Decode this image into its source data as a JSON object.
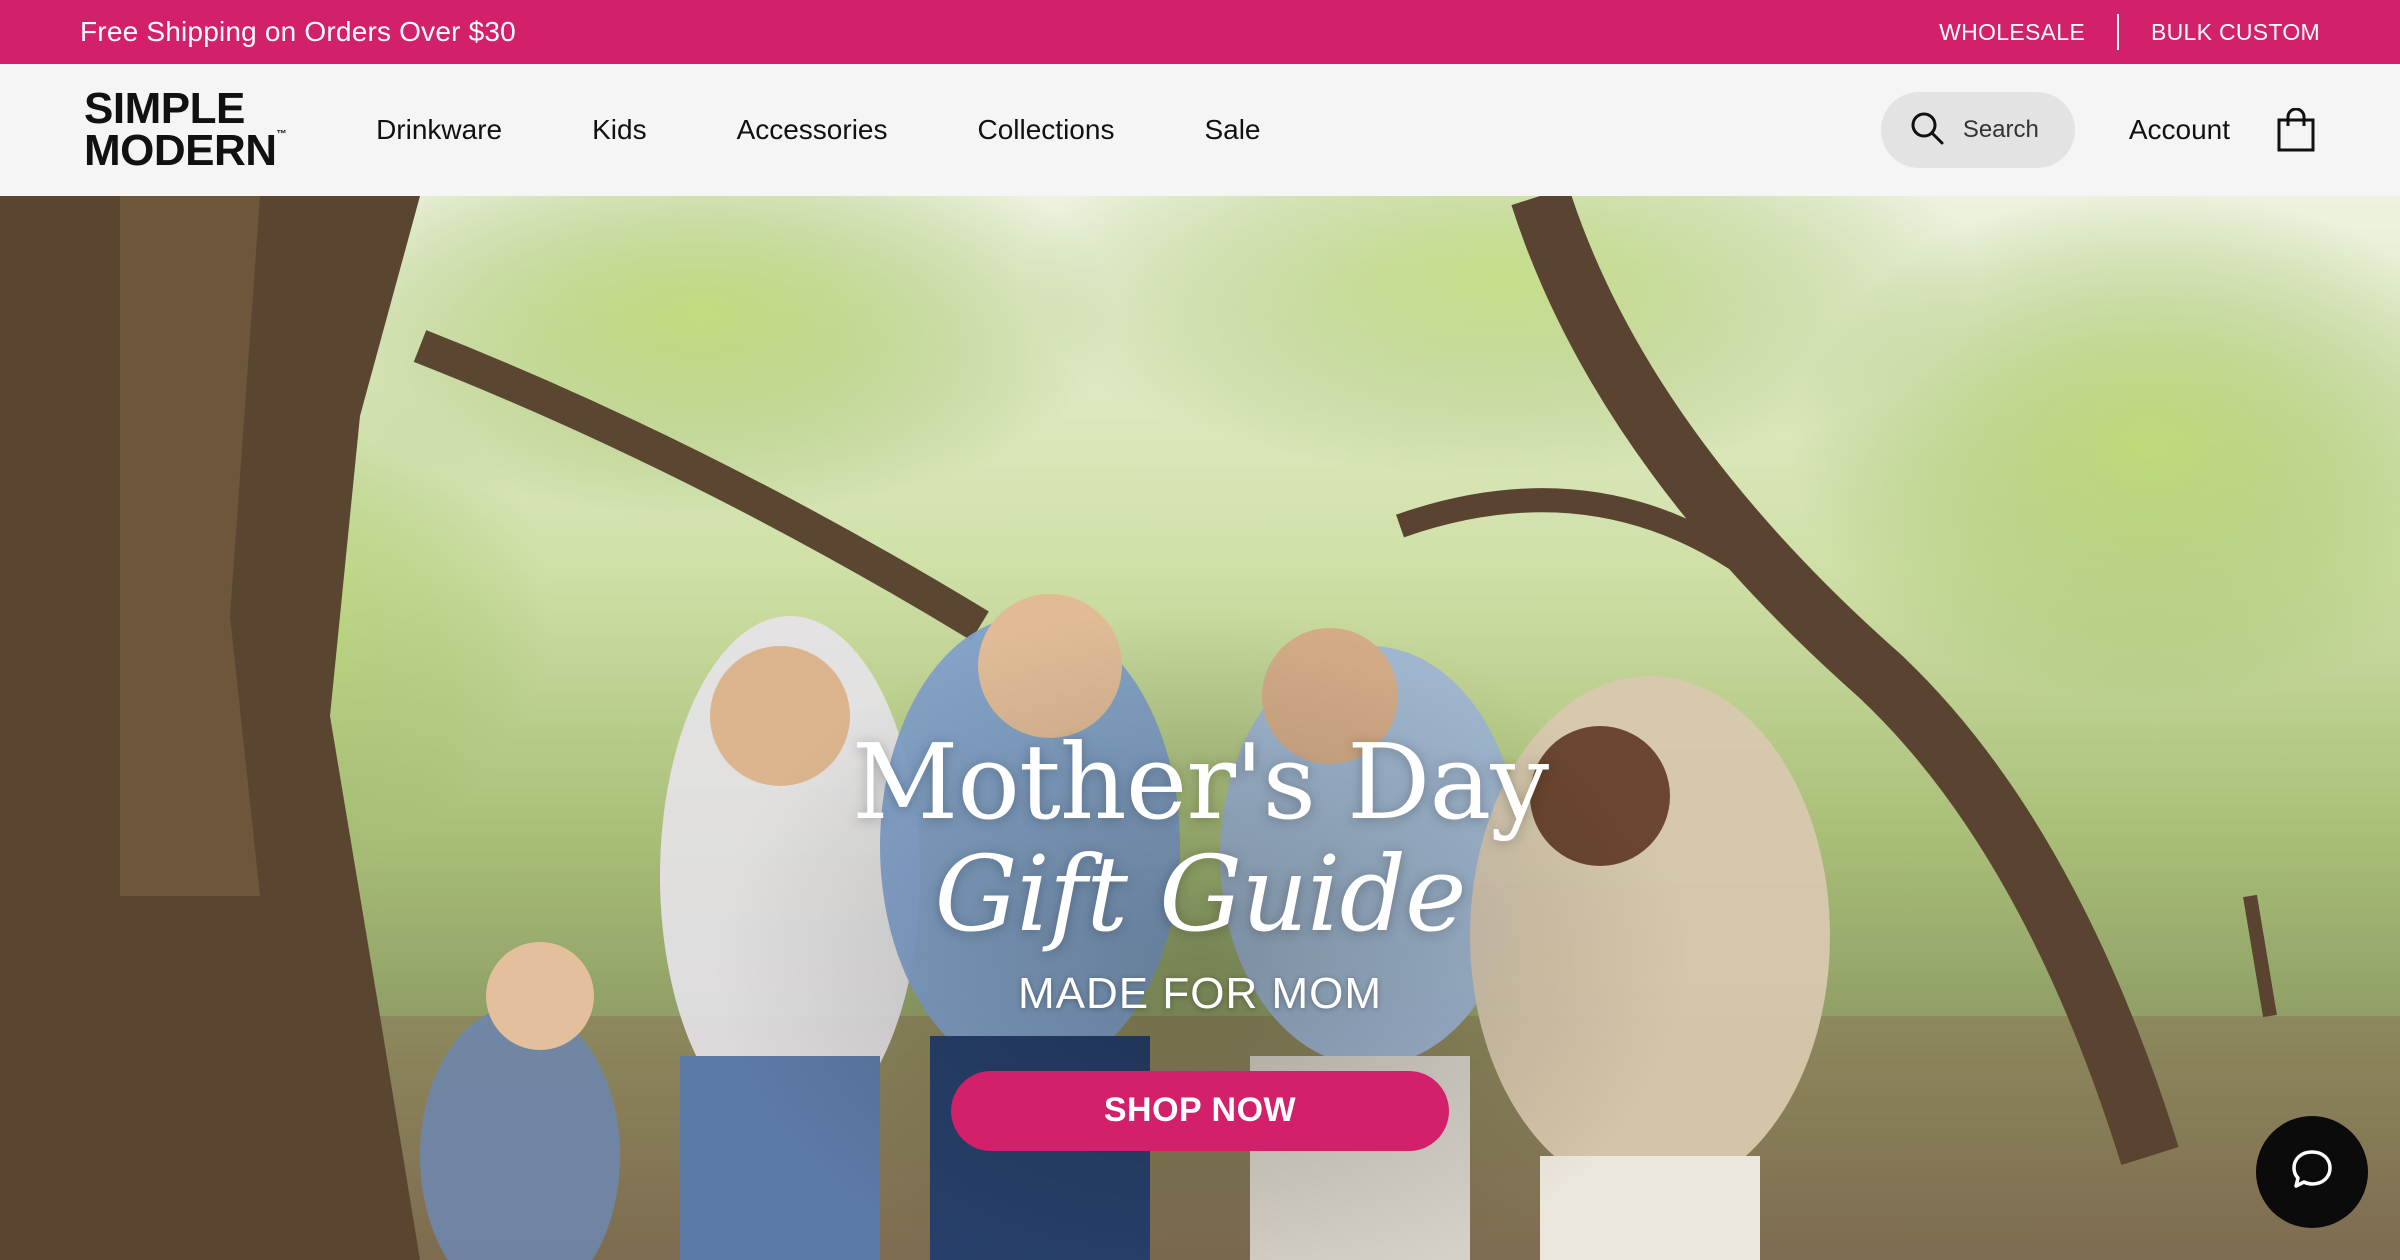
{
  "promo": {
    "text": "Free Shipping on Orders Over $30",
    "links": [
      "WHOLESALE",
      "BULK CUSTOM"
    ],
    "color": "#d2206a"
  },
  "header": {
    "logo_line1": "SIMPLE",
    "logo_line2": "MODERN",
    "logo_tm": "™",
    "nav": [
      "Drinkware",
      "Kids",
      "Accessories",
      "Collections",
      "Sale"
    ],
    "search_label": "Search",
    "account_label": "Account",
    "icons": [
      "search-icon",
      "shopping-bag-icon"
    ]
  },
  "hero": {
    "title": "Mother's Day",
    "subtitle": "Gift Guide",
    "tagline": "MADE FOR MOM",
    "cta": "SHOP NOW",
    "cta_color": "#d2206a"
  },
  "chat": {
    "icon": "chat-bubble-icon"
  }
}
